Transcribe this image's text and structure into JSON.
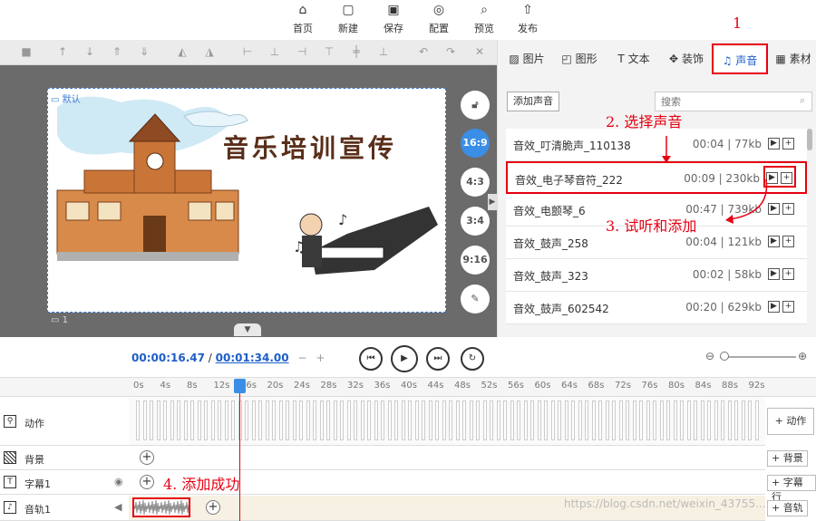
{
  "toolbar": {
    "items": [
      {
        "label": "首页",
        "icon": "home-icon"
      },
      {
        "label": "新建",
        "icon": "new-file-icon"
      },
      {
        "label": "保存",
        "icon": "save-icon"
      },
      {
        "label": "配置",
        "icon": "settings-icon"
      },
      {
        "label": "预览",
        "icon": "preview-icon"
      },
      {
        "label": "发布",
        "icon": "publish-icon"
      }
    ]
  },
  "canvas": {
    "default_label": "默认",
    "page_num": "1",
    "title_text": "音乐培训宣传"
  },
  "ratio_buttons": [
    "16:9",
    "4:3",
    "3:4",
    "9:16"
  ],
  "right_tabs": [
    {
      "label": "图片",
      "icon": "image-icon"
    },
    {
      "label": "图形",
      "icon": "shape-icon"
    },
    {
      "label": "文本",
      "icon": "text-icon"
    },
    {
      "label": "装饰",
      "icon": "decoration-icon"
    },
    {
      "label": "声音",
      "icon": "sound-icon"
    },
    {
      "label": "素材",
      "icon": "material-icon"
    }
  ],
  "sound_panel": {
    "add_label": "添加声音",
    "search_placeholder": "搜索",
    "items": [
      {
        "name": "音效_叮清脆声_110138",
        "meta": "00:04 | 77kb"
      },
      {
        "name": "音效_电子琴音符_222",
        "meta": "00:09 | 230kb"
      },
      {
        "name": "音效_电颤琴_6",
        "meta": "00:47 | 739kb"
      },
      {
        "name": "音效_鼓声_258",
        "meta": "00:04 | 121kb"
      },
      {
        "name": "音效_鼓声_323",
        "meta": "00:02 | 58kb"
      },
      {
        "name": "音效_鼓声_602542",
        "meta": "00:20 | 629kb"
      }
    ]
  },
  "player": {
    "current": "00:00:16.47",
    "separator": "/",
    "total": "00:01:34.00",
    "minus": "−",
    "plus": "+"
  },
  "timeline": {
    "ticks": [
      "0s",
      "4s",
      "8s",
      "12s",
      "16s",
      "20s",
      "24s",
      "28s",
      "32s",
      "36s",
      "40s",
      "44s",
      "48s",
      "52s",
      "56s",
      "60s",
      "64s",
      "68s",
      "72s",
      "76s",
      "80s",
      "84s",
      "88s",
      "92s"
    ],
    "tracks": [
      {
        "label": "动作",
        "right": "+ 动作"
      },
      {
        "label": "背景",
        "right": "+ 背景"
      },
      {
        "label": "字幕1",
        "right": "+ 字幕行"
      },
      {
        "label": "音轨1",
        "right": "+ 音轨"
      }
    ]
  },
  "annotations": {
    "n1": "1",
    "n2": "2. 选择声音",
    "n3": "3. 试听和添加",
    "n4": "4. 添加成功"
  },
  "watermark": "https://blog.csdn.net/weixin_43755..."
}
